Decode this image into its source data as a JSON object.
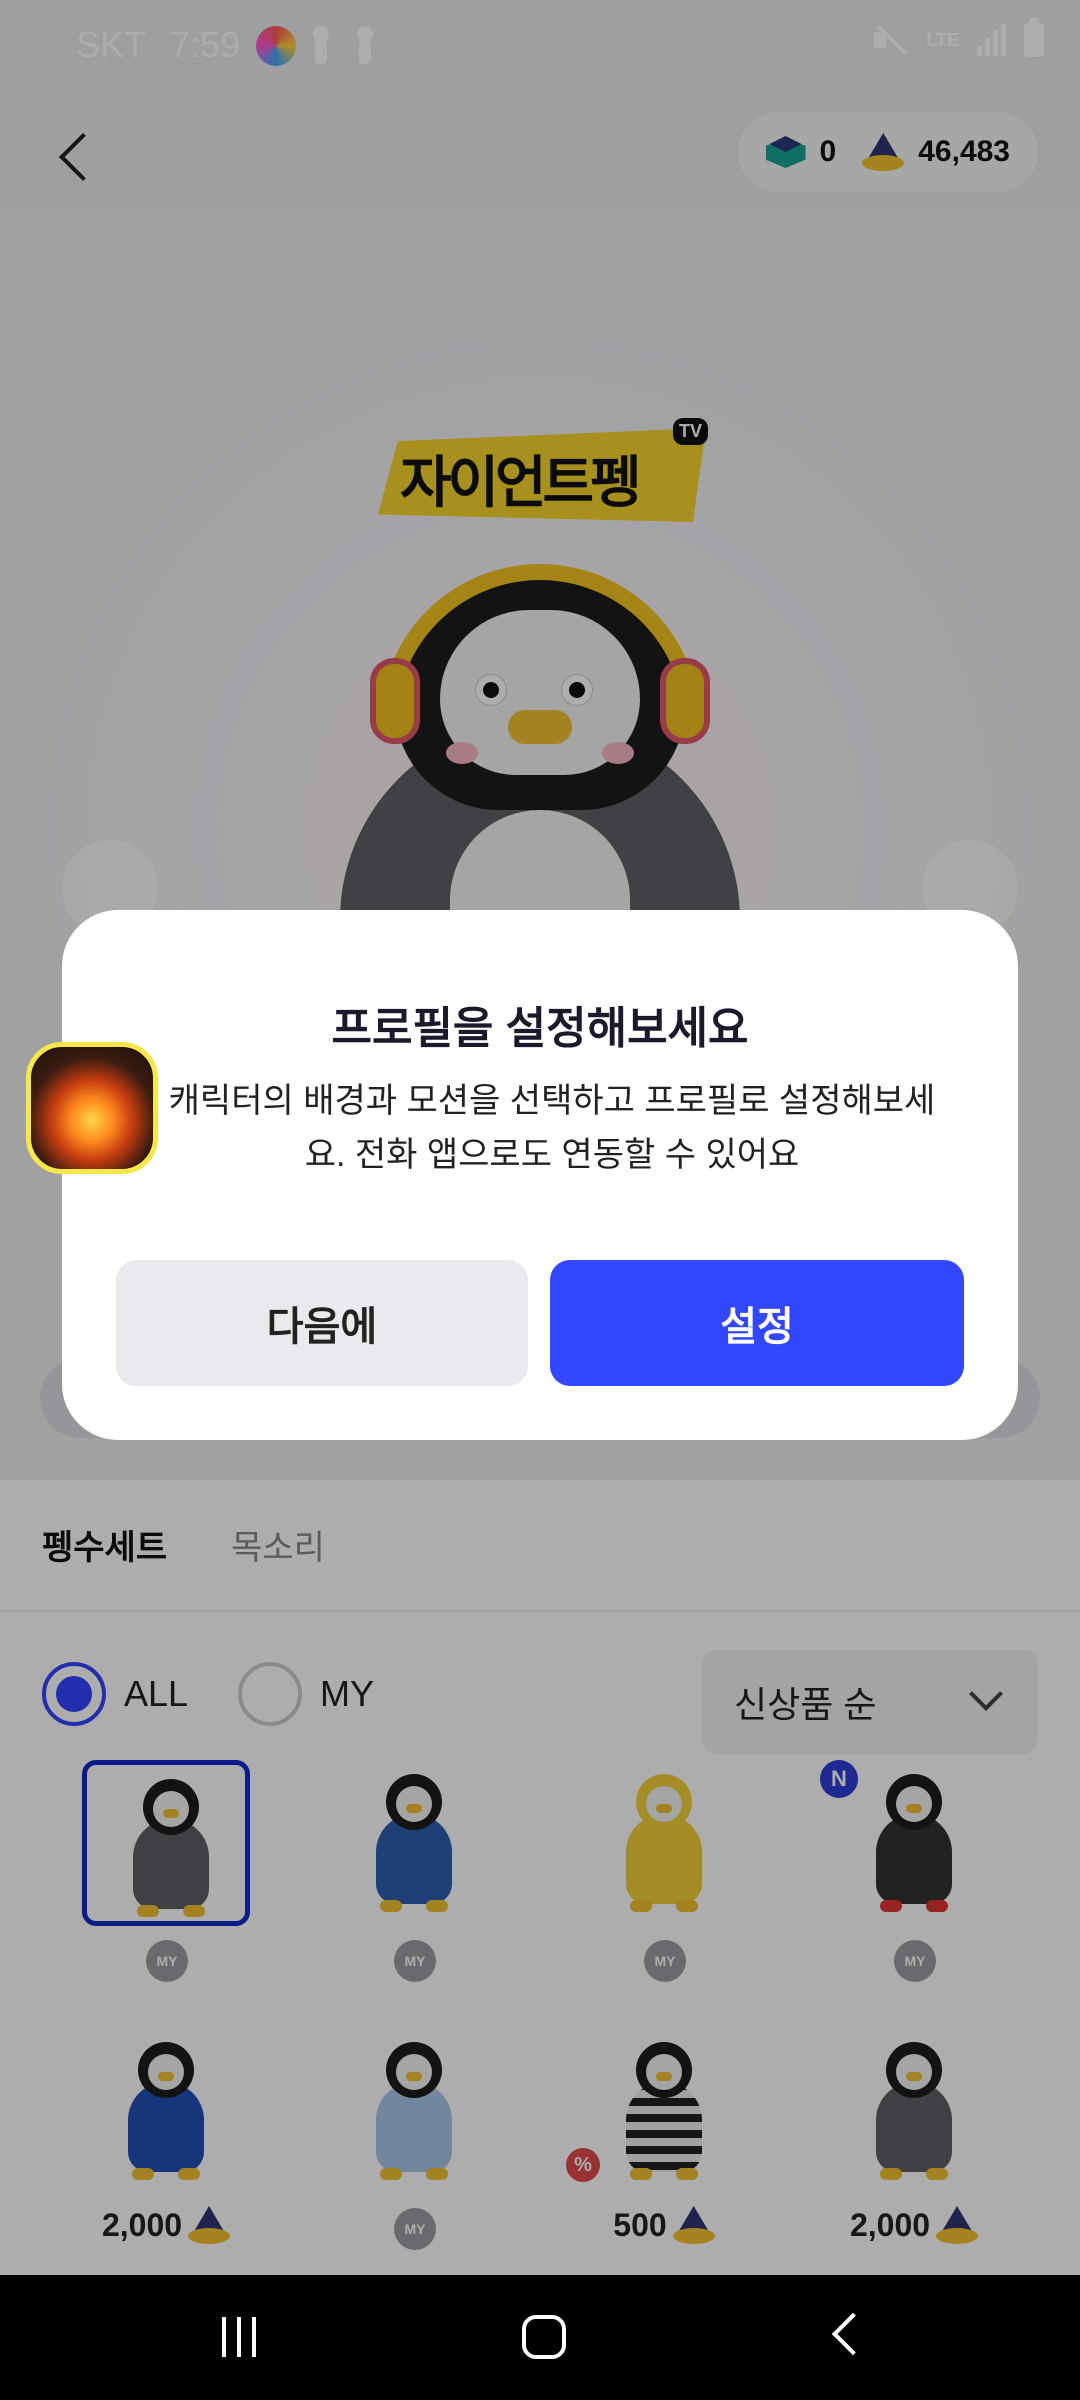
{
  "status_bar": {
    "carrier": "SKT",
    "time": "7:59",
    "network": "LTE"
  },
  "header": {
    "gem_count": "0",
    "cone_count": "46,483"
  },
  "hero": {
    "logo_text": "자이언트펭",
    "logo_badge": "TV"
  },
  "tabs": [
    {
      "label": "펭수세트",
      "active": true
    },
    {
      "label": "목소리",
      "active": false
    }
  ],
  "filters": {
    "all_label": "ALL",
    "my_label": "MY",
    "selected": "ALL",
    "sort_label": "신상품 순"
  },
  "grid_items": [
    {
      "badge": "MY",
      "selected": true
    },
    {
      "badge": "MY"
    },
    {
      "badge": "MY"
    },
    {
      "badge": "MY",
      "new_badge": "N"
    },
    {
      "price": "2,000"
    },
    {
      "badge": "MY"
    },
    {
      "price": "500",
      "sale_badge": "%"
    },
    {
      "price": "2,000"
    }
  ],
  "dialog": {
    "title": "프로필을 설정해보세요",
    "body": "캐릭터의 배경과 모션을 선택하고 프로필로 설정해보세요. 전화 앱으로도 연동할 수 있어요",
    "cancel_label": "다음에",
    "confirm_label": "설정"
  },
  "colors": {
    "accent": "#3347ff",
    "selected_border": "#1128c8",
    "brand_yellow": "#f6d42b"
  }
}
